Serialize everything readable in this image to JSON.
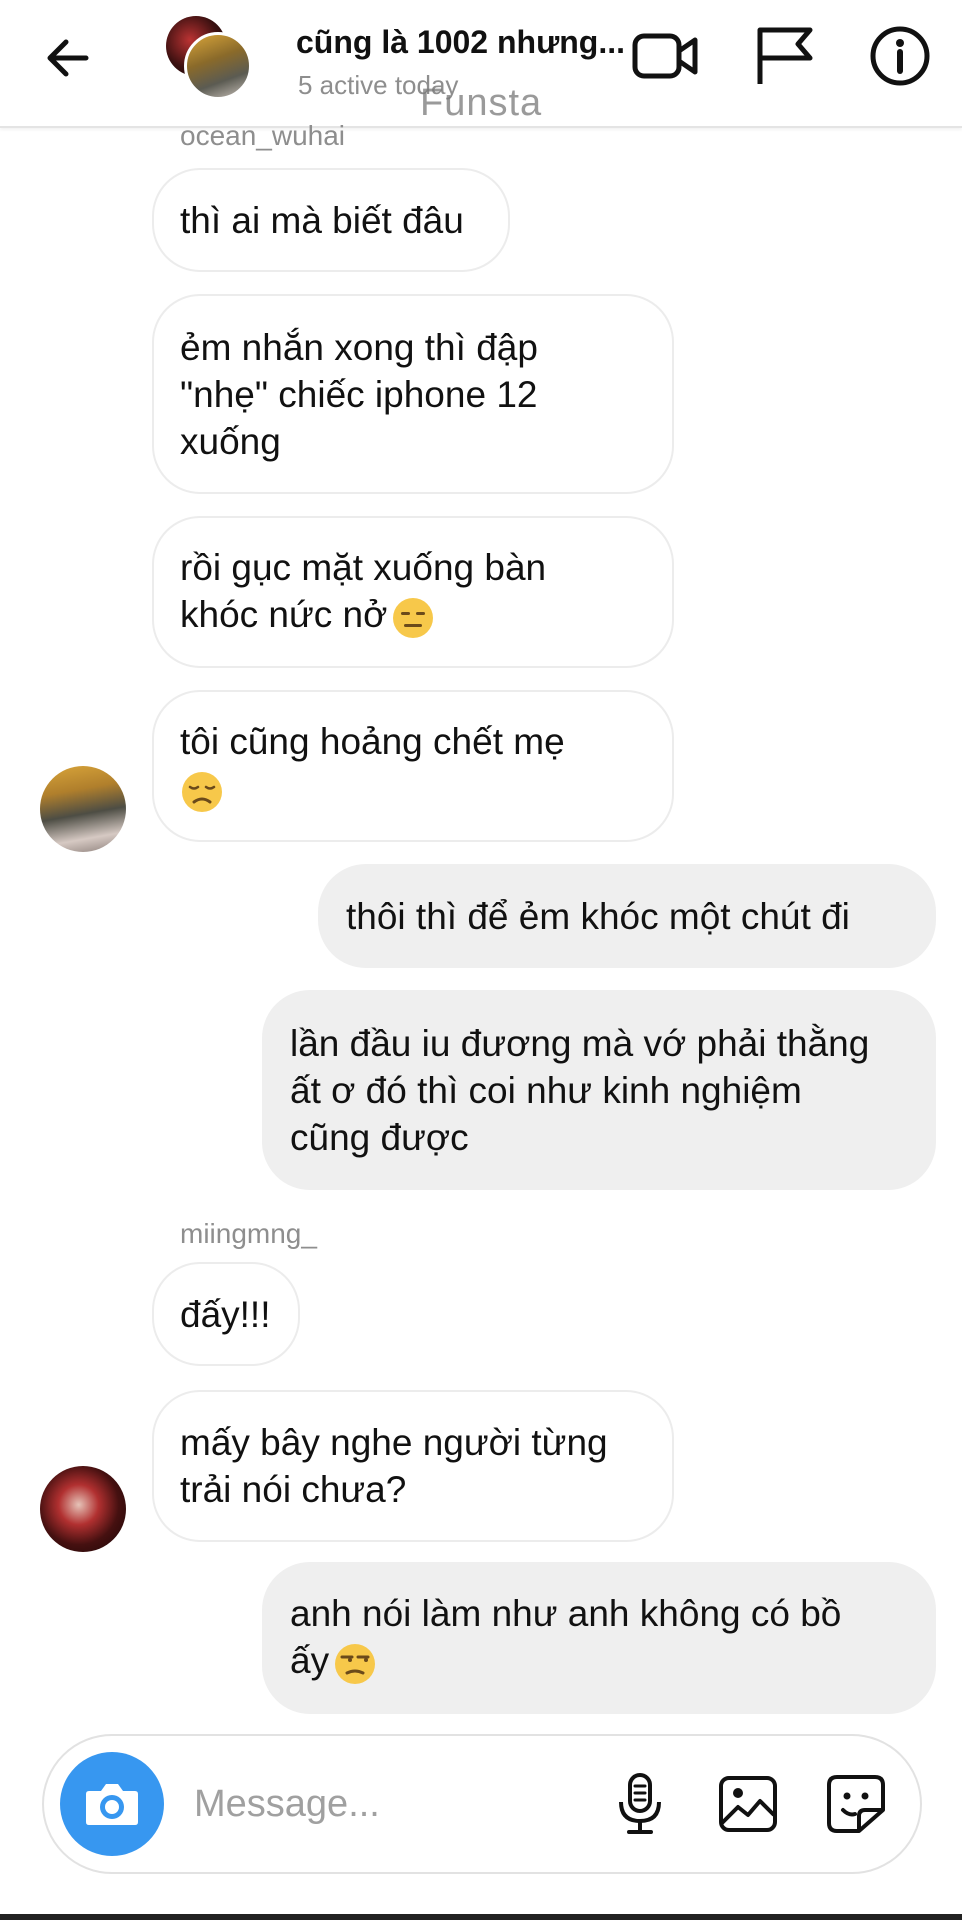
{
  "header": {
    "title": "cũng là 1002 nhưng...",
    "subtitle": "5 active today",
    "watermark": "Funsta",
    "icons": [
      "back-arrow-icon",
      "video-call-icon",
      "flag-icon",
      "info-icon"
    ]
  },
  "messages": [
    {
      "type": "sender",
      "text": "ocean_wuhai"
    },
    {
      "type": "in",
      "text": "thì ai mà biết đâu"
    },
    {
      "type": "in",
      "text": "ẻm nhắn xong thì đập\n\"nhẹ\" chiếc iphone 12\nxuống"
    },
    {
      "type": "in",
      "text": "rồi gục mặt xuống bàn\nkhóc nức nở",
      "emoji": "expressionless-face"
    },
    {
      "type": "in",
      "text": "tôi cũng hoảng chết mẹ",
      "emoji": "disappointed-face"
    },
    {
      "type": "out",
      "text": "thôi thì để ẻm khóc một chút đi"
    },
    {
      "type": "out",
      "text": "lần đầu iu đương mà vớ phải thằng\nất ơ đó thì coi như kinh nghiệm\ncũng được"
    },
    {
      "type": "sender",
      "text": "miingmng_"
    },
    {
      "type": "in",
      "text": "đấy!!!"
    },
    {
      "type": "in",
      "text": "mấy bây nghe người từng\ntrải nói chưa?"
    },
    {
      "type": "out",
      "text": "anh nói làm như anh không có bồ\nấy",
      "emoji": "unamused-face"
    }
  ],
  "composer": {
    "placeholder": "Message...",
    "icons": [
      "camera-icon",
      "microphone-icon",
      "gallery-icon",
      "sticker-icon"
    ]
  },
  "colors": {
    "accent": "#3797f0",
    "incoming_bubble_border": "#ececec",
    "outgoing_bubble_bg": "#efefef",
    "secondary_text": "#8e8e8e"
  }
}
